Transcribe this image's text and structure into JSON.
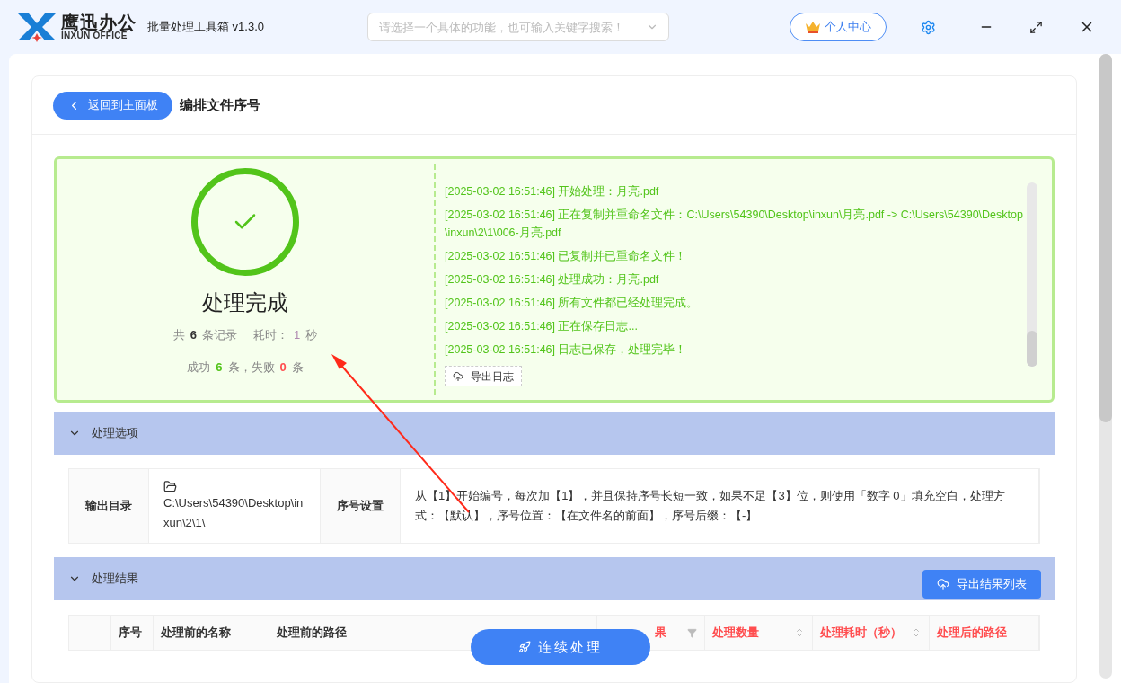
{
  "app": {
    "brand_cn": "鹰迅办公",
    "brand_en": "INXUN OFFICE",
    "title": "批量处理工具箱 v1.3.0"
  },
  "search": {
    "placeholder": "请选择一个具体的功能，也可输入关键字搜索！"
  },
  "account_button": "个人中心",
  "page": {
    "back_button": "返回到主面板",
    "title": "编排文件序号"
  },
  "result": {
    "heading": "处理完成",
    "stats_line_1": [
      {
        "kind": "muted",
        "text": "共"
      },
      {
        "kind": "strong",
        "text": "6"
      },
      {
        "kind": "muted",
        "text": "条记录"
      },
      {
        "kind": "gap",
        "text": "耗时："
      },
      {
        "kind": "time",
        "text": "1"
      },
      {
        "kind": "muted",
        "text": "秒"
      }
    ],
    "stats_line_2": [
      {
        "kind": "muted",
        "text": "成功"
      },
      {
        "kind": "success",
        "text": "6"
      },
      {
        "kind": "muted",
        "text": "条，失败"
      },
      {
        "kind": "fail",
        "text": "0"
      },
      {
        "kind": "muted",
        "text": "条"
      }
    ],
    "log": [
      "[2025-03-02 16:51:46] 开始处理：月亮.pdf",
      "[2025-03-02 16:51:46] 正在复制并重命名文件：C:\\Users\\54390\\Desktop\\inxun\\月亮.pdf -> C:\\Users\\54390\\Desktop\\inxun\\2\\1\\006-月亮.pdf",
      "[2025-03-02 16:51:46] 已复制并已重命名文件！",
      "[2025-03-02 16:51:46] 处理成功：月亮.pdf",
      "[2025-03-02 16:51:46] 所有文件都已经处理完成。",
      "[2025-03-02 16:51:46] 正在保存日志...",
      "[2025-03-02 16:51:46] 日志已保存，处理完毕！"
    ],
    "export_log_button": "导出日志"
  },
  "options_section": {
    "title": "处理选项",
    "expanded": true,
    "fields": [
      {
        "label": "输出目录",
        "value": "C:\\Users\\54390\\Desktop\\inxun\\2\\1\\"
      },
      {
        "label": "序号设置",
        "value": "从【1】开始编号，每次加【1】，并且保持序号长短一致，如果不足【3】位，则使用「数字 0」填充空白，处理方式：【默认】，序号位置：【在文件名的前面】，序号后缀：【-】"
      }
    ]
  },
  "results_section": {
    "title": "处理结果",
    "expanded": true,
    "export_button": "导出结果列表",
    "columns": [
      {
        "kind": "blank"
      },
      {
        "label": "序号",
        "kind": "plain",
        "highlight": false
      },
      {
        "label": "处理前的名称",
        "kind": "plain",
        "highlight": false
      },
      {
        "label": "处理前的路径",
        "kind": "plain",
        "highlight": false
      },
      {
        "label": "果",
        "kind": "filter",
        "highlight": true
      },
      {
        "label": "处理数量",
        "kind": "sort",
        "highlight": true
      },
      {
        "label": "处理耗时（秒）",
        "kind": "sort",
        "highlight": true
      },
      {
        "label": "处理后的路径",
        "kind": "plain",
        "highlight": true
      }
    ]
  },
  "continue_button": "连续处理"
}
